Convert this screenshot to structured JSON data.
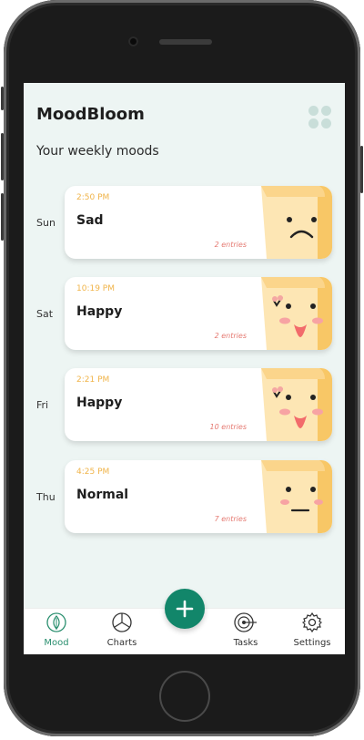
{
  "app": {
    "title": "MoodBloom",
    "subtitle": "Your weekly moods"
  },
  "entries": [
    {
      "day": "Sun",
      "time": "2:50 PM",
      "mood": "Sad",
      "count": "2 entries"
    },
    {
      "day": "Sat",
      "time": "10:19 PM",
      "mood": "Happy",
      "count": "2 entries"
    },
    {
      "day": "Fri",
      "time": "2:21 PM",
      "mood": "Happy",
      "count": "10 entries"
    },
    {
      "day": "Thu",
      "time": "4:25 PM",
      "mood": "Normal",
      "count": "7 entries"
    }
  ],
  "tabs": {
    "mood": "Mood",
    "charts": "Charts",
    "tasks": "Tasks",
    "settings": "Settings"
  },
  "icons": {
    "menu": "grid-icon",
    "mood": "leaf-icon",
    "charts": "pie-chart-icon",
    "add": "plus-icon",
    "tasks": "target-icon",
    "settings": "gear-icon"
  },
  "colors": {
    "accent": "#12866a",
    "time": "#f0b44a",
    "entries": "#e57b73",
    "screen_bg": "#edf5f3",
    "toast": "#fde6b4"
  }
}
